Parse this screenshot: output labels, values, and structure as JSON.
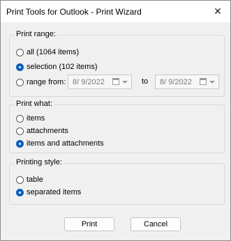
{
  "window": {
    "title": "Print Tools for Outlook - Print Wizard",
    "close_glyph": "✕"
  },
  "print_range": {
    "label": "Print range:",
    "options": [
      {
        "label": "all (1064 items)",
        "checked": false
      },
      {
        "label": "selection (102 items)",
        "checked": true
      },
      {
        "label": "range from:",
        "checked": false
      }
    ],
    "from_date": "8/  9/2022",
    "to_label": "to",
    "to_date": "8/  9/2022"
  },
  "print_what": {
    "label": "Print what:",
    "options": [
      {
        "label": "items",
        "checked": false
      },
      {
        "label": "attachments",
        "checked": false
      },
      {
        "label": "items and attachments",
        "checked": true
      }
    ]
  },
  "printing_style": {
    "label": "Printing style:",
    "options": [
      {
        "label": "table",
        "checked": false
      },
      {
        "label": "separated items",
        "checked": true
      }
    ]
  },
  "buttons": {
    "print": "Print",
    "cancel": "Cancel"
  },
  "icons": {
    "calendar": "calendar-icon",
    "dropdown": "chevron-down-icon",
    "close": "close-icon"
  },
  "colors": {
    "accent": "#0a5fbf"
  }
}
